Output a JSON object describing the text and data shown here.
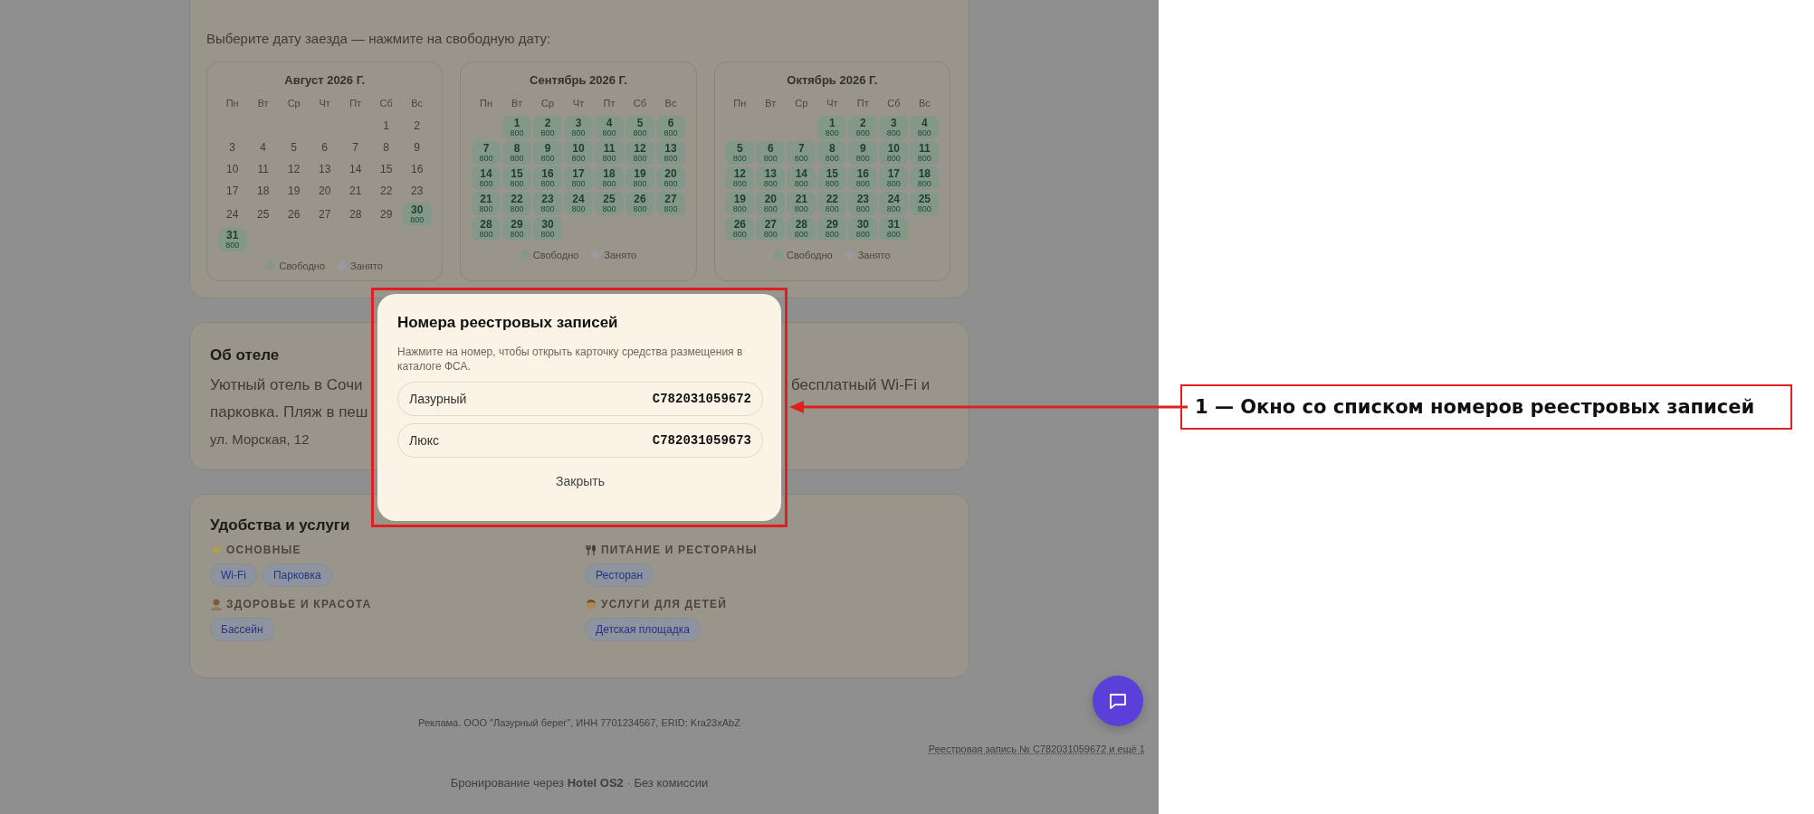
{
  "booking": {
    "prompt": "Выберите дату заезда — нажмите на свободную дату:",
    "calendars": [
      {
        "title": "Август 2026 Г.",
        "weekdays": [
          "Пн",
          "Вт",
          "Ср",
          "Чт",
          "Пт",
          "Сб",
          "Вс"
        ],
        "weeks": [
          [
            {
              "kind": "empty"
            },
            {
              "kind": "empty"
            },
            {
              "kind": "empty"
            },
            {
              "kind": "empty"
            },
            {
              "kind": "empty"
            },
            {
              "kind": "day",
              "day": "1",
              "available": false
            },
            {
              "kind": "day",
              "day": "2",
              "available": false
            }
          ],
          [
            {
              "kind": "day",
              "day": "3",
              "available": false
            },
            {
              "kind": "day",
              "day": "4",
              "available": false
            },
            {
              "kind": "day",
              "day": "5",
              "available": false
            },
            {
              "kind": "day",
              "day": "6",
              "available": false
            },
            {
              "kind": "day",
              "day": "7",
              "available": false
            },
            {
              "kind": "day",
              "day": "8",
              "available": false
            },
            {
              "kind": "day",
              "day": "9",
              "available": false
            }
          ],
          [
            {
              "kind": "day",
              "day": "10",
              "available": false
            },
            {
              "kind": "day",
              "day": "11",
              "available": false
            },
            {
              "kind": "day",
              "day": "12",
              "available": false
            },
            {
              "kind": "day",
              "day": "13",
              "available": false
            },
            {
              "kind": "day",
              "day": "14",
              "available": false
            },
            {
              "kind": "day",
              "day": "15",
              "available": false
            },
            {
              "kind": "day",
              "day": "16",
              "available": false
            }
          ],
          [
            {
              "kind": "day",
              "day": "17",
              "available": false
            },
            {
              "kind": "day",
              "day": "18",
              "available": false
            },
            {
              "kind": "day",
              "day": "19",
              "available": false
            },
            {
              "kind": "day",
              "day": "20",
              "available": false
            },
            {
              "kind": "day",
              "day": "21",
              "available": false
            },
            {
              "kind": "day",
              "day": "22",
              "available": false
            },
            {
              "kind": "day",
              "day": "23",
              "available": false
            }
          ],
          [
            {
              "kind": "day",
              "day": "24",
              "available": false
            },
            {
              "kind": "day",
              "day": "25",
              "available": false
            },
            {
              "kind": "day",
              "day": "26",
              "available": false
            },
            {
              "kind": "day",
              "day": "27",
              "available": false
            },
            {
              "kind": "day",
              "day": "28",
              "available": false
            },
            {
              "kind": "day",
              "day": "29",
              "available": false
            },
            {
              "kind": "day",
              "day": "30",
              "available": true,
              "price": "800"
            }
          ],
          [
            {
              "kind": "day",
              "day": "31",
              "available": true,
              "price": "800"
            }
          ]
        ],
        "legend": [
          {
            "label": "Свободно",
            "kind": "free"
          },
          {
            "label": "Занято",
            "kind": "busy"
          }
        ]
      },
      {
        "title": "Сентябрь 2026 Г.",
        "weekdays": [
          "Пн",
          "Вт",
          "Ср",
          "Чт",
          "Пт",
          "Сб",
          "Вс"
        ],
        "weeks": [
          [
            {
              "kind": "empty"
            },
            {
              "kind": "day",
              "day": "1",
              "available": true,
              "price": "800"
            },
            {
              "kind": "day",
              "day": "2",
              "available": true,
              "price": "800"
            },
            {
              "kind": "day",
              "day": "3",
              "available": true,
              "price": "800"
            },
            {
              "kind": "day",
              "day": "4",
              "available": true,
              "price": "800"
            },
            {
              "kind": "day",
              "day": "5",
              "available": true,
              "price": "800"
            },
            {
              "kind": "day",
              "day": "6",
              "available": true,
              "price": "800"
            }
          ],
          [
            {
              "kind": "day",
              "day": "7",
              "available": true,
              "price": "800"
            },
            {
              "kind": "day",
              "day": "8",
              "available": true,
              "price": "800"
            },
            {
              "kind": "day",
              "day": "9",
              "available": true,
              "price": "800"
            },
            {
              "kind": "day",
              "day": "10",
              "available": true,
              "price": "800"
            },
            {
              "kind": "day",
              "day": "11",
              "available": true,
              "price": "800"
            },
            {
              "kind": "day",
              "day": "12",
              "available": true,
              "price": "800"
            },
            {
              "kind": "day",
              "day": "13",
              "available": true,
              "price": "800"
            }
          ],
          [
            {
              "kind": "day",
              "day": "14",
              "available": true,
              "price": "800"
            },
            {
              "kind": "day",
              "day": "15",
              "available": true,
              "price": "800"
            },
            {
              "kind": "day",
              "day": "16",
              "available": true,
              "price": "800"
            },
            {
              "kind": "day",
              "day": "17",
              "available": true,
              "price": "800"
            },
            {
              "kind": "day",
              "day": "18",
              "available": true,
              "price": "800"
            },
            {
              "kind": "day",
              "day": "19",
              "available": true,
              "price": "800"
            },
            {
              "kind": "day",
              "day": "20",
              "available": true,
              "price": "800"
            }
          ],
          [
            {
              "kind": "day",
              "day": "21",
              "available": true,
              "price": "800"
            },
            {
              "kind": "day",
              "day": "22",
              "available": true,
              "price": "800"
            },
            {
              "kind": "day",
              "day": "23",
              "available": true,
              "price": "800"
            },
            {
              "kind": "day",
              "day": "24",
              "available": true,
              "price": "800"
            },
            {
              "kind": "day",
              "day": "25",
              "available": true,
              "price": "800"
            },
            {
              "kind": "day",
              "day": "26",
              "available": true,
              "price": "800"
            },
            {
              "kind": "day",
              "day": "27",
              "available": true,
              "price": "800"
            }
          ],
          [
            {
              "kind": "day",
              "day": "28",
              "available": true,
              "price": "800"
            },
            {
              "kind": "day",
              "day": "29",
              "available": true,
              "price": "800"
            },
            {
              "kind": "day",
              "day": "30",
              "available": true,
              "price": "800"
            }
          ]
        ],
        "legend": [
          {
            "label": "Свободно",
            "kind": "free"
          },
          {
            "label": "Занято",
            "kind": "busy"
          }
        ]
      },
      {
        "title": "Октябрь 2026 Г.",
        "weekdays": [
          "Пн",
          "Вт",
          "Ср",
          "Чт",
          "Пт",
          "Сб",
          "Вс"
        ],
        "weeks": [
          [
            {
              "kind": "empty"
            },
            {
              "kind": "empty"
            },
            {
              "kind": "empty"
            },
            {
              "kind": "day",
              "day": "1",
              "available": true,
              "price": "800"
            },
            {
              "kind": "day",
              "day": "2",
              "available": true,
              "price": "800"
            },
            {
              "kind": "day",
              "day": "3",
              "available": true,
              "price": "800"
            },
            {
              "kind": "day",
              "day": "4",
              "available": true,
              "price": "800"
            }
          ],
          [
            {
              "kind": "day",
              "day": "5",
              "available": true,
              "price": "800"
            },
            {
              "kind": "day",
              "day": "6",
              "available": true,
              "price": "800"
            },
            {
              "kind": "day",
              "day": "7",
              "available": true,
              "price": "800"
            },
            {
              "kind": "day",
              "day": "8",
              "available": true,
              "price": "800"
            },
            {
              "kind": "day",
              "day": "9",
              "available": true,
              "price": "800"
            },
            {
              "kind": "day",
              "day": "10",
              "available": true,
              "price": "800"
            },
            {
              "kind": "day",
              "day": "11",
              "available": true,
              "price": "800"
            }
          ],
          [
            {
              "kind": "day",
              "day": "12",
              "available": true,
              "price": "800"
            },
            {
              "kind": "day",
              "day": "13",
              "available": true,
              "price": "800"
            },
            {
              "kind": "day",
              "day": "14",
              "available": true,
              "price": "800"
            },
            {
              "kind": "day",
              "day": "15",
              "available": true,
              "price": "800"
            },
            {
              "kind": "day",
              "day": "16",
              "available": true,
              "price": "800"
            },
            {
              "kind": "day",
              "day": "17",
              "available": true,
              "price": "800"
            },
            {
              "kind": "day",
              "day": "18",
              "available": true,
              "price": "800"
            }
          ],
          [
            {
              "kind": "day",
              "day": "19",
              "available": true,
              "price": "800"
            },
            {
              "kind": "day",
              "day": "20",
              "available": true,
              "price": "800"
            },
            {
              "kind": "day",
              "day": "21",
              "available": true,
              "price": "800"
            },
            {
              "kind": "day",
              "day": "22",
              "available": true,
              "price": "800"
            },
            {
              "kind": "day",
              "day": "23",
              "available": true,
              "price": "800"
            },
            {
              "kind": "day",
              "day": "24",
              "available": true,
              "price": "800"
            },
            {
              "kind": "day",
              "day": "25",
              "available": true,
              "price": "800"
            }
          ],
          [
            {
              "kind": "day",
              "day": "26",
              "available": true,
              "price": "800"
            },
            {
              "kind": "day",
              "day": "27",
              "available": true,
              "price": "800"
            },
            {
              "kind": "day",
              "day": "28",
              "available": true,
              "price": "800"
            },
            {
              "kind": "day",
              "day": "29",
              "available": true,
              "price": "800"
            },
            {
              "kind": "day",
              "day": "30",
              "available": true,
              "price": "800"
            },
            {
              "kind": "day",
              "day": "31",
              "available": true,
              "price": "800"
            }
          ]
        ],
        "legend": [
          {
            "label": "Свободно",
            "kind": "free"
          },
          {
            "label": "Занято",
            "kind": "busy"
          }
        ]
      }
    ]
  },
  "about": {
    "title": "Об отеле",
    "visible_text": [
      {
        "text": "Уютный отель в Сочи",
        "kind": "left"
      },
      {
        "text": "бесплатный Wi-Fi и",
        "kind": "right"
      },
      {
        "text": "парковка. Пляж в пеш",
        "kind": "left"
      }
    ],
    "address": "ул. Морская, 12"
  },
  "amenities": {
    "title": "Удобства и услуги",
    "groups": [
      {
        "kind": "sparkle",
        "heading": "ОСНОВНЫЕ",
        "tags": [
          "Wi-Fi",
          "Парковка"
        ]
      },
      {
        "kind": "dining",
        "heading": "ПИТАНИЕ И РЕСТОРАНЫ",
        "tags": [
          "Ресторан"
        ]
      },
      {
        "kind": "wellness",
        "heading": "ЗДОРОВЬЕ И КРАСОТА",
        "tags": [
          "Бассейн"
        ]
      },
      {
        "kind": "kids",
        "heading": "УСЛУГИ ДЛЯ ДЕТЕЙ",
        "tags": [
          "Детская площадка"
        ]
      }
    ]
  },
  "footer": {
    "ad": "Реклама. ООО \"Лазурный берег\", ИНН 7701234567, ERID: Kra23xAbZ",
    "registry_link": "Реестровая запись № C782031059672 и ещё 1",
    "booking_note": "Бронирование через **Hotel OS2** · Без комиссии"
  },
  "modal": {
    "title": "Номера реестровых записей",
    "hint": "Нажмите на номер, чтобы открыть карточку средства размещения в каталоге ФСА.",
    "records": [
      {
        "name": "Лазурный",
        "code": "C782031059672"
      },
      {
        "name": "Люкс",
        "code": "C782031059673"
      }
    ],
    "close": "Закрыть"
  },
  "annotation": {
    "label": "1 — Окно со списком номеров реестровых записей"
  }
}
